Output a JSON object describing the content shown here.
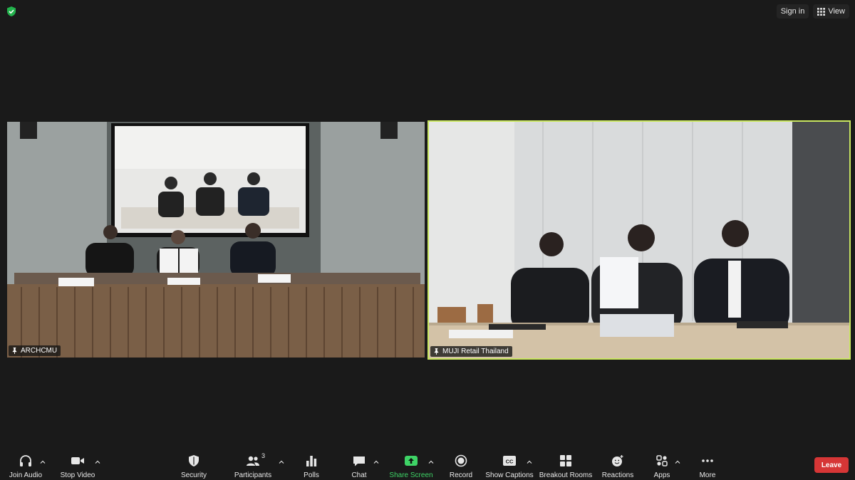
{
  "header": {
    "sign_in": "Sign in",
    "view": "View",
    "accent_green": "#3ed366"
  },
  "tiles": [
    {
      "name": "ARCHCMU",
      "icon": "pin-icon"
    },
    {
      "name": "MUJI Retail Thailand",
      "icon": "pin-icon",
      "active_speaker_color": "#c9e660"
    }
  ],
  "toolbar": {
    "join_audio": "Join Audio",
    "stop_video": "Stop Video",
    "security": "Security",
    "participants": "Participants",
    "participants_count": "3",
    "polls": "Polls",
    "chat": "Chat",
    "share_screen": "Share Screen",
    "record": "Record",
    "show_captions": "Show Captions",
    "breakout_rooms": "Breakout Rooms",
    "reactions": "Reactions",
    "apps": "Apps",
    "more": "More",
    "leave": "Leave",
    "leave_color": "#d63636"
  }
}
